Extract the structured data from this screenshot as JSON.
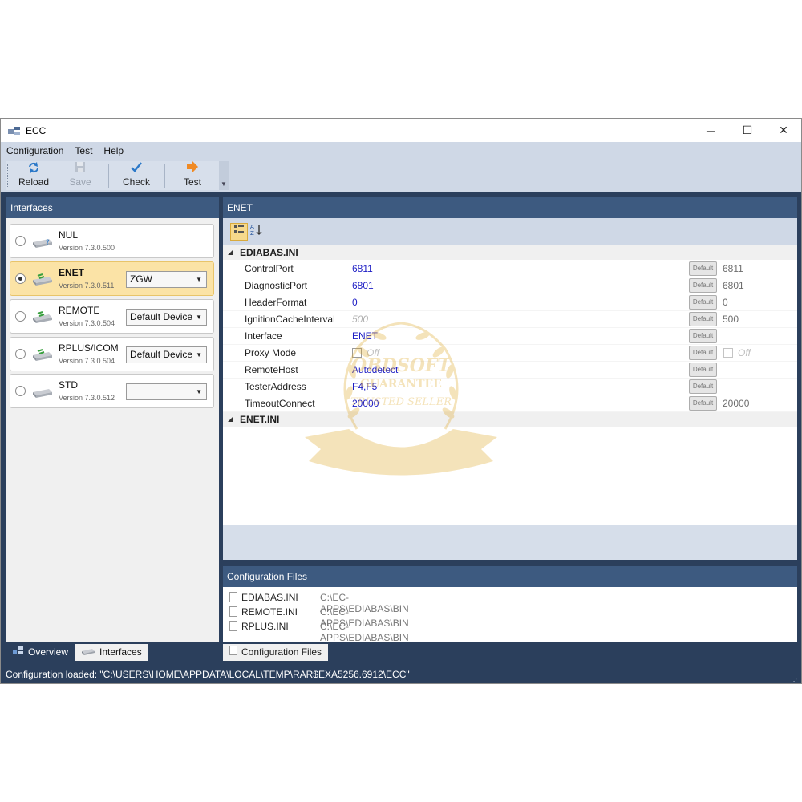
{
  "window": {
    "title": "ECC",
    "minimize_glyph": "─",
    "maximize_glyph": "☐",
    "close_glyph": "✕"
  },
  "menu": [
    "Configuration",
    "Test",
    "Help"
  ],
  "toolbar": {
    "reload_label": "Reload",
    "save_label": "Save",
    "check_label": "Check",
    "test_label": "Test"
  },
  "interfaces": {
    "header": "Interfaces",
    "items": [
      {
        "name": "NUL",
        "version": "Version 7.3.0.500",
        "selected": false,
        "device": null
      },
      {
        "name": "ENET",
        "version": "Version 7.3.0.511",
        "selected": true,
        "device": "ZGW"
      },
      {
        "name": "REMOTE",
        "version": "Version 7.3.0.504",
        "selected": false,
        "device": "Default Device"
      },
      {
        "name": "RPLUS/ICOM",
        "version": "Version 7.3.0.504",
        "selected": false,
        "device": "Default Device"
      },
      {
        "name": "STD",
        "version": "Version 7.3.0.512",
        "selected": false,
        "device": ""
      }
    ]
  },
  "bottom_tabs": {
    "overview": "Overview",
    "interfaces": "Interfaces",
    "config_files": "Configuration Files"
  },
  "properties": {
    "header": "ENET",
    "category1": "EDIABAS.INI",
    "category2": "ENET.INI",
    "default_label": "Default",
    "rows": [
      {
        "name": "ControlPort",
        "value": "6811",
        "default": "6811"
      },
      {
        "name": "DiagnosticPort",
        "value": "6801",
        "default": "6801"
      },
      {
        "name": "HeaderFormat",
        "value": "0",
        "default": "0"
      },
      {
        "name": "IgnitionCacheInterval",
        "value": "500",
        "default": "500"
      },
      {
        "name": "Interface",
        "value": "ENET",
        "default": ""
      },
      {
        "name": "Proxy Mode",
        "value": "Off",
        "default": "Off"
      },
      {
        "name": "RemoteHost",
        "value": "Autodetect",
        "default": ""
      },
      {
        "name": "TesterAddress",
        "value": "F4,F5",
        "default": ""
      },
      {
        "name": "TimeoutConnect",
        "value": "20000",
        "default": "20000"
      }
    ]
  },
  "config_files": {
    "header": "Configuration Files",
    "files": [
      {
        "name": "EDIABAS.INI",
        "path": "C:\\EC-APPS\\EDIABAS\\BIN"
      },
      {
        "name": "REMOTE.INI",
        "path": "C:\\EC-APPS\\EDIABAS\\BIN"
      },
      {
        "name": "RPLUS.INI",
        "path": "C:\\EC-APPS\\EDIABAS\\BIN"
      }
    ]
  },
  "status": "Configuration loaded: \"C:\\USERS\\HOME\\APPDATA\\LOCAL\\TEMP\\RAR$EXA5256.6912\\ECC\"",
  "watermark": {
    "line1": "OBDSOFT",
    "line2": "GUARANTEE",
    "line3": "TRUSTED SELLER"
  },
  "colors": {
    "frame": "#2b3f5c",
    "panel_header": "#3d5a80",
    "selected": "#fbe3a6",
    "value_text": "#1c1cc4"
  }
}
